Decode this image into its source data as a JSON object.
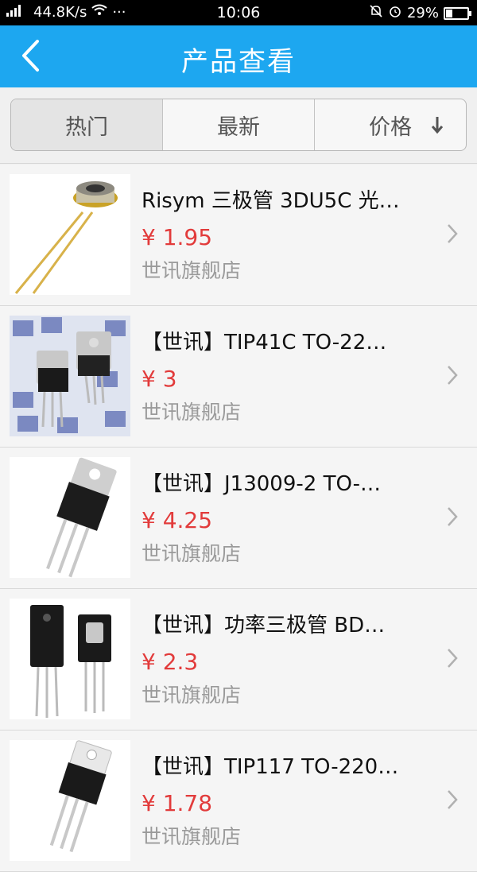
{
  "status_bar": {
    "network": "44.8K/s",
    "more": "···",
    "time": "10:06",
    "battery_percent": "29%",
    "battery_level": 0.29
  },
  "header": {
    "title": "产品查看",
    "back_icon": "chevron-left-icon"
  },
  "tabs": [
    {
      "label": "热门",
      "active": true
    },
    {
      "label": "最新",
      "active": false
    },
    {
      "label": "价格",
      "active": false,
      "icon": "arrow-down-icon"
    }
  ],
  "products": [
    {
      "name": "Risym 三极管 3DU5C 光…",
      "price": "¥ 1.95",
      "shop": "世讯旗舰店",
      "image": "phototransistor"
    },
    {
      "name": "【世讯】TIP41C TO-22…",
      "price": "¥ 3",
      "shop": "世讯旗舰店",
      "image": "to220-pair"
    },
    {
      "name": "【世讯】J13009-2 TO-…",
      "price": "¥ 4.25",
      "shop": "世讯旗舰店",
      "image": "to220"
    },
    {
      "name": "【世讯】功率三极管 BD…",
      "price": "¥ 2.3",
      "shop": "世讯旗舰店",
      "image": "to126-pair"
    },
    {
      "name": "【世讯】TIP117 TO-220…",
      "price": "¥ 1.78",
      "shop": "世讯旗舰店",
      "image": "to220-white"
    }
  ]
}
